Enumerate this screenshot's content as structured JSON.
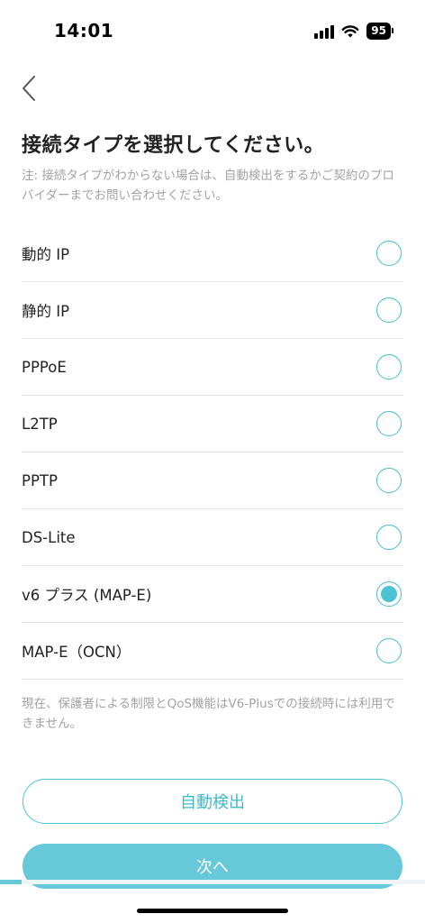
{
  "status_bar": {
    "time": "14:01",
    "battery": "95"
  },
  "header": {
    "title": "接続タイプを選択してください。"
  },
  "note": "注: 接続タイプがわからない場合は、自動検出をするかご契約のプロバイダーまでお問い合わせください。",
  "options": [
    {
      "label": "動的 IP",
      "selected": false
    },
    {
      "label": "静的 IP",
      "selected": false
    },
    {
      "label": "PPPoE",
      "selected": false
    },
    {
      "label": "L2TP",
      "selected": false
    },
    {
      "label": "PPTP",
      "selected": false
    },
    {
      "label": "DS-Lite",
      "selected": false
    },
    {
      "label": "v6 プラス (MAP-E)",
      "selected": true
    },
    {
      "label": "MAP-E（OCN）",
      "selected": false
    }
  ],
  "footnote": "現在、保護者による制限とQoS機能はV6-Plusでの接続時には利用できません。",
  "buttons": {
    "auto_detect": "自動検出",
    "next": "次へ"
  },
  "progress": {
    "fraction": 0.05
  },
  "colors": {
    "accent": "#4cc3d4",
    "next_button": "#66c8d8",
    "muted_text": "#a3a3a3"
  },
  "icons": {
    "back": "chevron-left-icon",
    "wifi": "wifi-icon",
    "signal": "cellular-signal-icon",
    "battery": "battery-icon"
  }
}
